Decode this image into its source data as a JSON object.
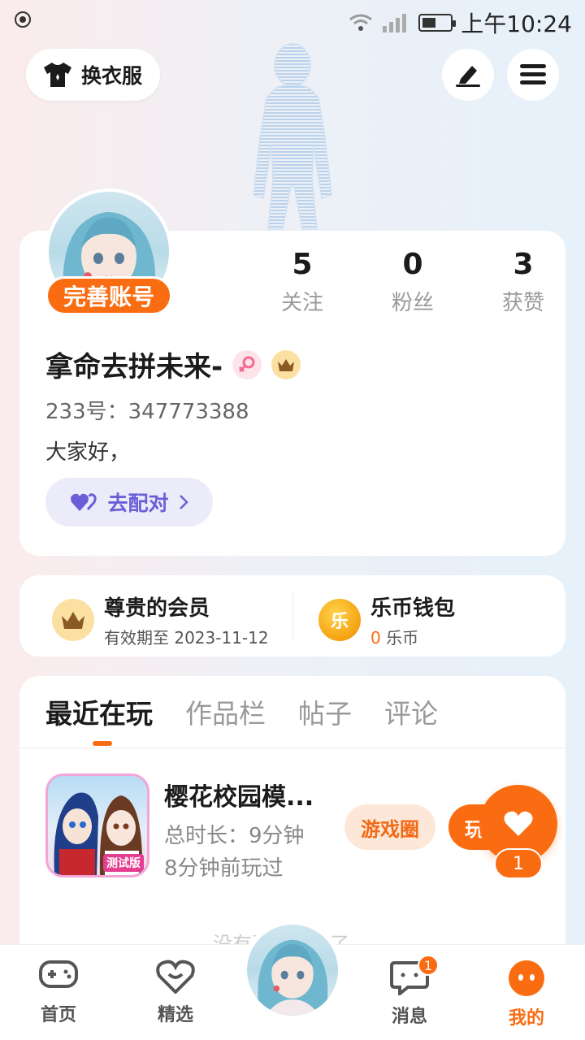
{
  "status_bar": {
    "time": "上午10:24"
  },
  "top": {
    "change_clothes_label": "换衣服"
  },
  "profile": {
    "complete_label": "完善账号",
    "stats": [
      {
        "num": "5",
        "label": "关注"
      },
      {
        "num": "0",
        "label": "粉丝"
      },
      {
        "num": "3",
        "label": "获赞"
      }
    ],
    "username": "拿命去拼未来-",
    "uid": "233号：347773388",
    "bio": "大家好，",
    "match_label": "去配对"
  },
  "membership": {
    "vip_title": "尊贵的会员",
    "vip_sub": "有效期至 2023-11-12",
    "wallet_title": "乐币钱包",
    "wallet_amount": "0",
    "wallet_unit": "乐币",
    "coin_glyph": "乐"
  },
  "tabs": [
    {
      "label": "最近在玩",
      "active": true
    },
    {
      "label": "作品栏",
      "active": false
    },
    {
      "label": "帖子",
      "active": false
    },
    {
      "label": "评论",
      "active": false
    }
  ],
  "game": {
    "title": "樱花校园模...",
    "duration": "总时长：9分钟",
    "last_played": "8分钟前玩过",
    "circle_label": "游戏圈",
    "play_label": "玩",
    "icon_badge": "测试版"
  },
  "like": {
    "count": "1"
  },
  "faded_text": "没有更多内容了",
  "bottom_nav": {
    "home": "首页",
    "featured": "精选",
    "messages": "消息",
    "messages_badge": "1",
    "me": "我的"
  },
  "colors": {
    "accent": "#fa6c11",
    "match": "#6a5fd6"
  }
}
